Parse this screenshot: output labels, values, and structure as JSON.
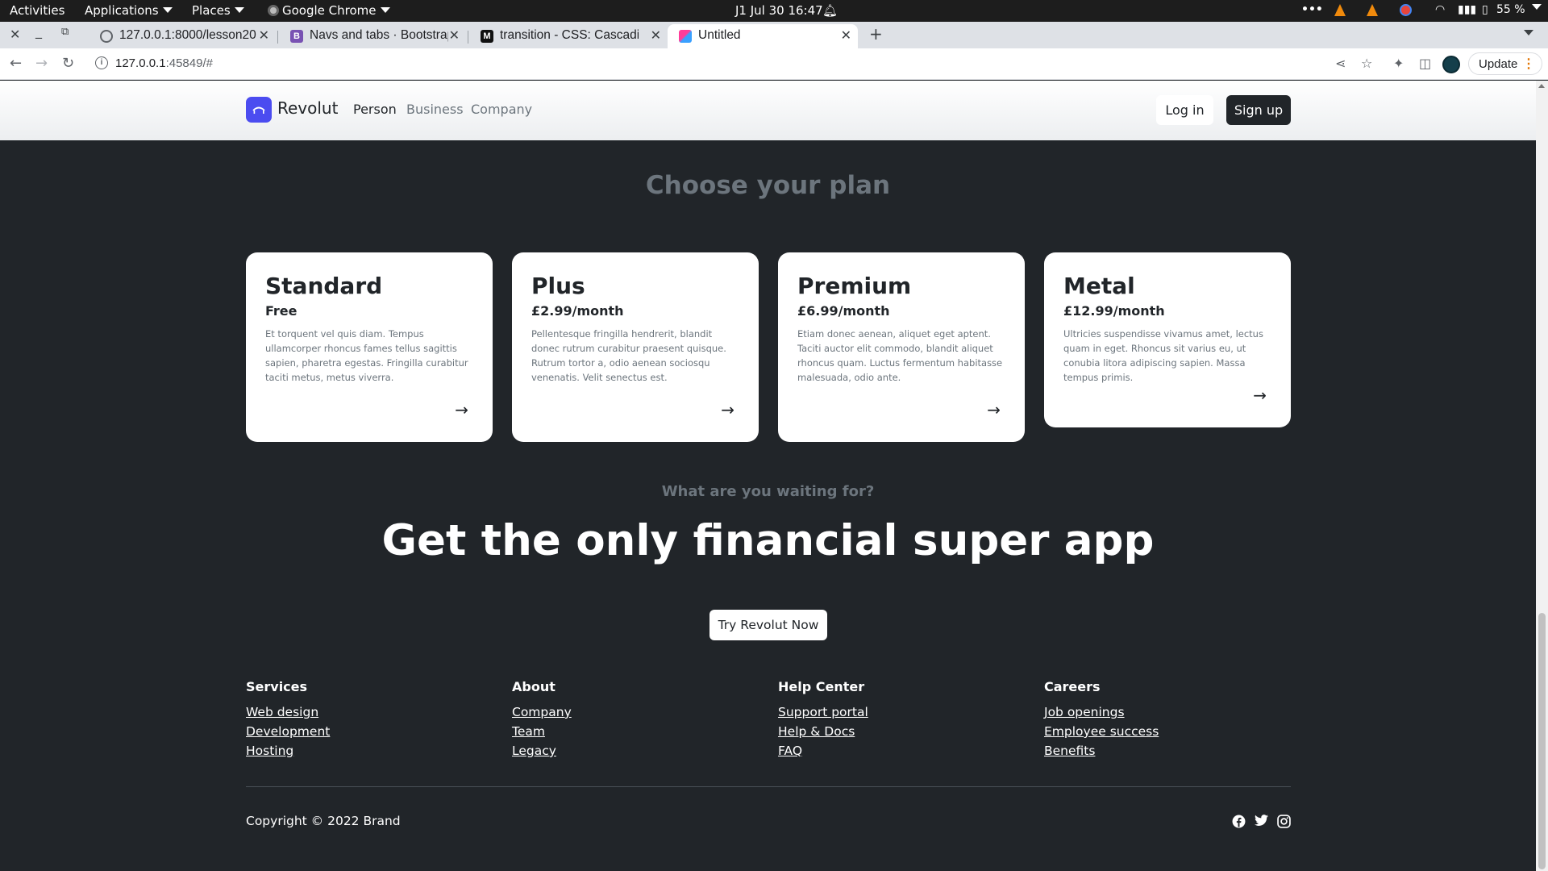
{
  "topbar": {
    "activities": "Activities",
    "applications": "Applications",
    "places": "Places",
    "chrome": "Google Chrome",
    "datetime": "J1 Jul 30  16:47",
    "battery": "55 %"
  },
  "tabs": [
    {
      "title": "127.0.0.1:8000/lesson20"
    },
    {
      "title": "Navs and tabs · Bootstrap"
    },
    {
      "title": "transition - CSS: Cascading"
    },
    {
      "title": "Untitled"
    }
  ],
  "toolbar": {
    "url_host": "127.0.0.1",
    "url_rest": ":45849/#",
    "update_label": "Update"
  },
  "nav": {
    "brand": "Revolut",
    "links": [
      "Person",
      "Business",
      "Company"
    ],
    "login": "Log in",
    "signup": "Sign up"
  },
  "plans": {
    "title": "Choose your plan",
    "items": [
      {
        "name": "Standard",
        "price": "Free",
        "desc": "Et torquent vel quis diam. Tempus ullamcorper rhoncus fames tellus sagittis sapien, pharetra egestas. Fringilla curabitur taciti metus, metus viverra."
      },
      {
        "name": "Plus",
        "price": "£2.99/month",
        "desc": "Pellentesque fringilla hendrerit, blandit donec rutrum curabitur praesent quisque. Rutrum tortor a, odio aenean sociosqu venenatis. Velit senectus est."
      },
      {
        "name": "Premium",
        "price": "£6.99/month",
        "desc": "Etiam donec aenean, aliquet eget aptent. Taciti auctor elit commodo, blandit aliquet rhoncus quam. Luctus fermentum habitasse malesuada, odio ante."
      },
      {
        "name": "Metal",
        "price": "£12.99/month",
        "desc": "Ultricies suspendisse vivamus amet, lectus quam in eget. Rhoncus sit varius eu, ut conubia litora adipiscing sapien. Massa tempus primis."
      }
    ]
  },
  "cta": {
    "kicker": "What are you waiting for?",
    "headline": "Get the only financial super app",
    "button": "Try Revolut Now"
  },
  "footer": {
    "columns": [
      {
        "title": "Services",
        "links": [
          "Web design",
          "Development",
          "Hosting"
        ]
      },
      {
        "title": "About",
        "links": [
          "Company",
          "Team",
          "Legacy"
        ]
      },
      {
        "title": "Help Center",
        "links": [
          "Support portal",
          "Help & Docs",
          "FAQ"
        ]
      },
      {
        "title": "Careers",
        "links": [
          "Job openings",
          "Employee success",
          "Benefits"
        ]
      }
    ],
    "copyright": "Copyright © 2022 Brand",
    "social": [
      "facebook-icon",
      "twitter-icon",
      "instagram-icon"
    ]
  },
  "colors": {
    "page_bg": "#212529",
    "brand_logo": "#4b4cf0",
    "muted": "#6c757d"
  }
}
